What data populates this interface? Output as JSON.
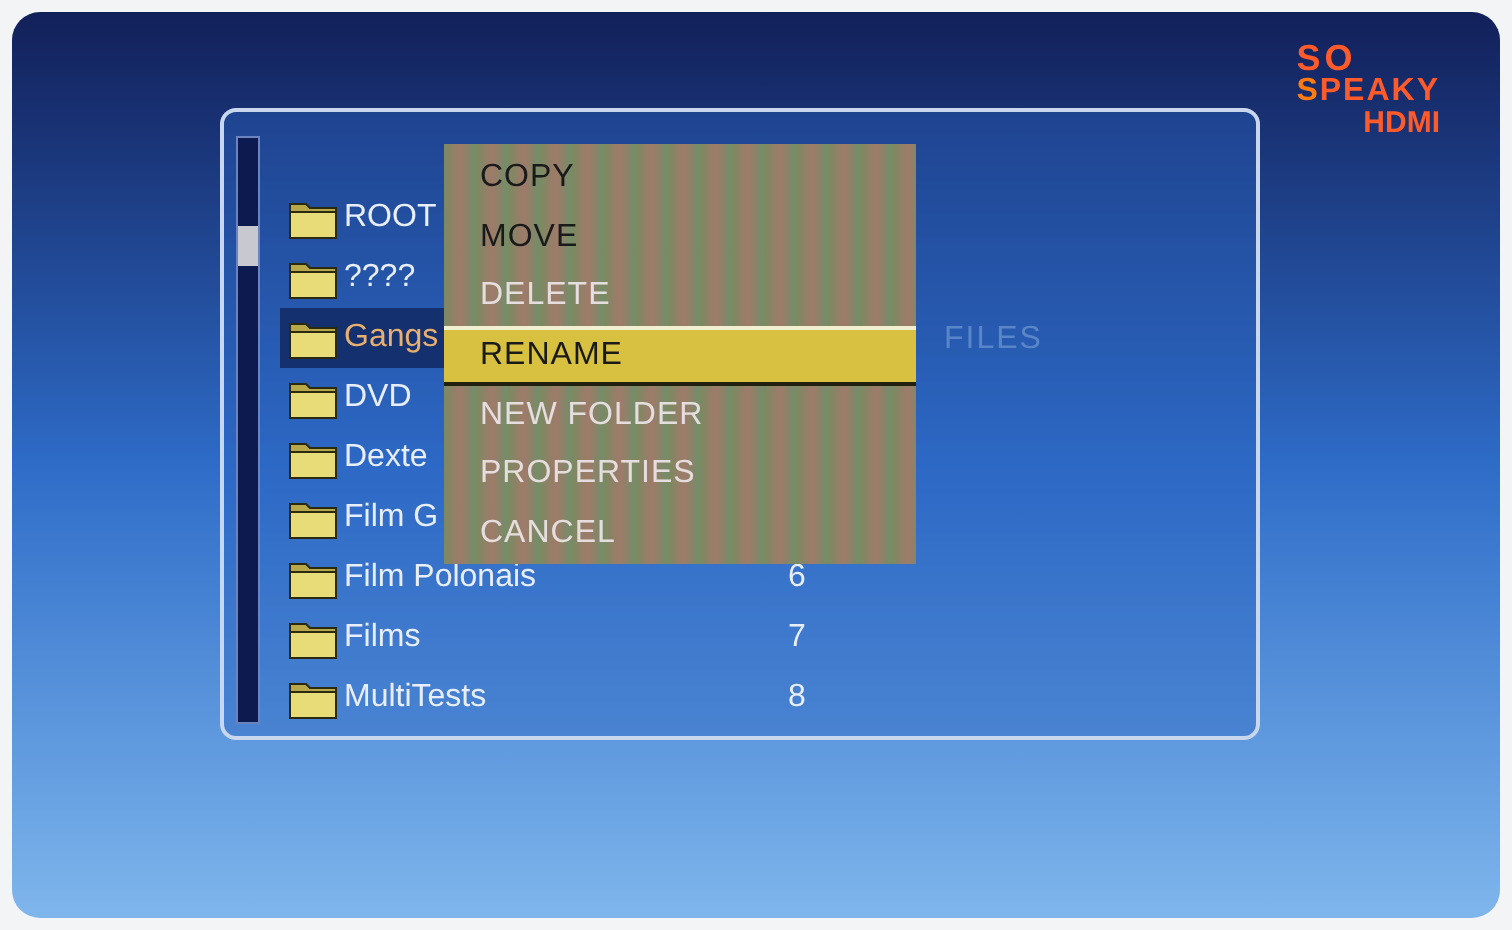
{
  "logo": {
    "line_1": "SO",
    "line_2_initial": "S",
    "line_2_rest": "PEAKY",
    "line_3": "HDMI"
  },
  "files_label": "FILES",
  "folders": [
    {
      "name": "ROOT",
      "selected": false
    },
    {
      "name": "????",
      "selected": false
    },
    {
      "name": "Gangs",
      "selected": true
    },
    {
      "name": "DVD",
      "selected": false
    },
    {
      "name": "Dexte",
      "selected": false
    },
    {
      "name": "Film G",
      "selected": false
    },
    {
      "name": "Film Polonais",
      "number": "6",
      "selected": false
    },
    {
      "name": "Films",
      "number": "7",
      "selected": false
    },
    {
      "name": "MultiTests",
      "number": "8",
      "selected": false
    }
  ],
  "menu": [
    {
      "label": "COPY",
      "disabled": true,
      "selected": false
    },
    {
      "label": "MOVE",
      "disabled": true,
      "selected": false
    },
    {
      "label": "DELETE",
      "disabled": false,
      "selected": false
    },
    {
      "label": "RENAME",
      "disabled": false,
      "selected": true
    },
    {
      "label": "NEW FOLDER",
      "disabled": false,
      "selected": false
    },
    {
      "label": "PROPERTIES",
      "disabled": false,
      "selected": false
    },
    {
      "label": "CANCEL",
      "disabled": false,
      "selected": false
    }
  ]
}
